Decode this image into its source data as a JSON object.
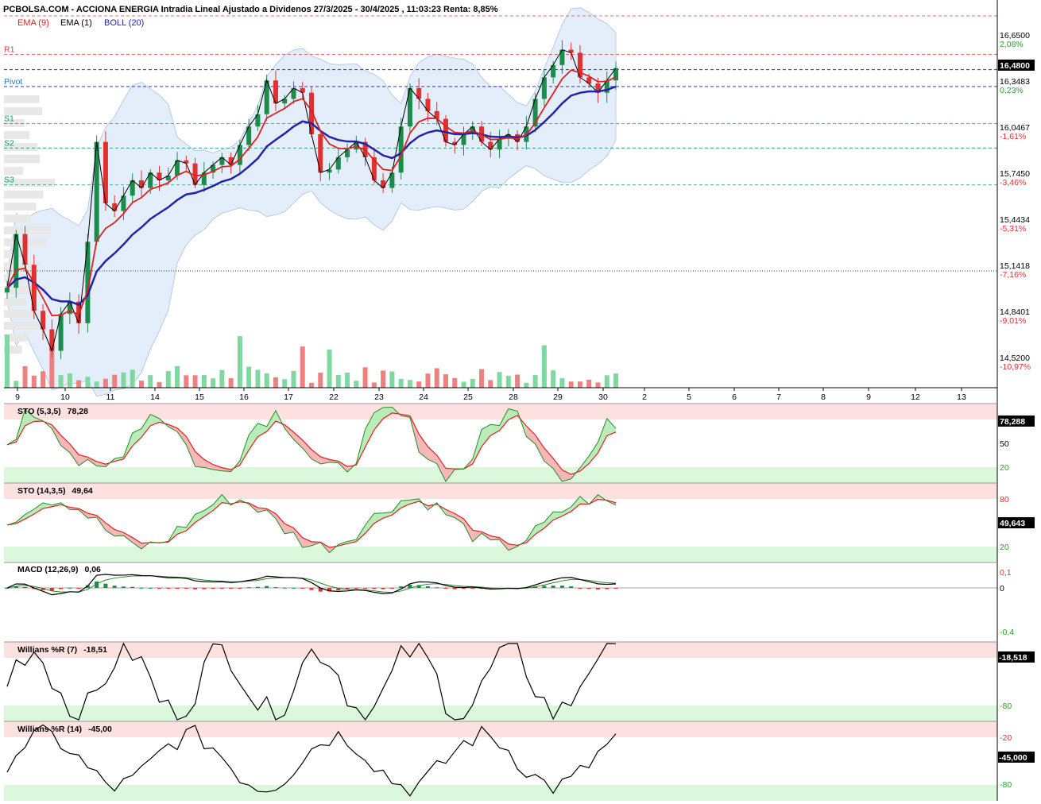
{
  "title": "PCBOLSA.COM - ACCIONA ENERGIA Intradia Lineal Ajustado a Dividenos 27/3/2025 - 30/4/2025 , 11:03:23 Renta: 8,85%",
  "legend": [
    {
      "label": "EMA (9)",
      "color": "#e02020"
    },
    {
      "label": "EMA (1)",
      "color": "#000000"
    },
    {
      "label": "BOLL (20)",
      "color": "#2020c0"
    }
  ],
  "colors": {
    "up": "#1c8c4c",
    "down": "#e03030",
    "volUp": "#7ed8a0",
    "volDown": "#ee8080",
    "ema9": "#e02020",
    "ema20": "#2222aa",
    "boll": "#c8dcf4",
    "pivot": "#1a1aa8",
    "overbought": "#fde0e0",
    "oversold": "#dcf8dc"
  },
  "chart_data": [
    {
      "type": "candlestick",
      "ylim": [
        14.4,
        16.82
      ],
      "price_ticks": [
        {
          "value": "16,6500",
          "pct": "2,08%"
        },
        {
          "value": "16,3483",
          "pct": "0,23%"
        },
        {
          "value": "16,0467",
          "pct": "-1,61%"
        },
        {
          "value": "15,7450",
          "pct": "-3,46%"
        },
        {
          "value": "15,4434",
          "pct": "-5,31%"
        },
        {
          "value": "15,1418",
          "pct": "-7,16%"
        },
        {
          "value": "14,8401",
          "pct": "-9,01%"
        },
        {
          "value": "14,5200",
          "pct": "-10,97%"
        }
      ],
      "last_price": "16,4800",
      "levels": [
        {
          "name": "R1",
          "value": 16.57,
          "color": "#e04040"
        },
        {
          "name": "Pivot",
          "value": 16.36,
          "color": "#1a7ad0"
        },
        {
          "name": "S1",
          "value": 16.12,
          "color": "#1a9a6a"
        },
        {
          "name": "S2",
          "value": 15.96,
          "color": "#1a9a6a"
        },
        {
          "name": "S3",
          "value": 15.72,
          "color": "#1a9a6a"
        }
      ],
      "x_ticks": [
        "9",
        "10",
        "11",
        "14",
        "15",
        "16",
        "17",
        "22",
        "23",
        "24",
        "25",
        "28",
        "29",
        "30",
        "2",
        "5",
        "6",
        "7",
        "8",
        "9",
        "12",
        "13"
      ],
      "close": [
        15.05,
        15.4,
        15.2,
        14.9,
        14.78,
        14.64,
        14.88,
        14.96,
        14.82,
        15.35,
        16.0,
        15.6,
        15.55,
        15.65,
        15.75,
        15.7,
        15.8,
        15.75,
        15.78,
        15.88,
        15.86,
        15.72,
        15.8,
        15.85,
        15.9,
        15.85,
        15.98,
        16.1,
        16.18,
        16.4,
        16.25,
        16.28,
        16.35,
        16.32,
        16.05,
        15.8,
        15.82,
        15.9,
        15.95,
        16.0,
        15.9,
        15.75,
        15.7,
        15.8,
        16.1,
        16.35,
        16.28,
        16.2,
        16.15,
        16.0,
        15.98,
        16.05,
        16.1,
        16.0,
        15.95,
        16.02,
        16.05,
        16.0,
        16.1,
        16.28,
        16.42,
        16.5,
        16.6,
        16.58,
        16.42,
        16.38,
        16.32,
        16.4,
        16.48
      ]
    },
    {
      "type": "line",
      "name": "STO (5,3,5)",
      "value": "78,28",
      "box": "78,288",
      "ticks": [
        "50",
        "20"
      ]
    },
    {
      "type": "line",
      "name": "STO (14,3,5)",
      "value": "49,64",
      "box": "49,643",
      "ticks": [
        "80",
        "20"
      ]
    },
    {
      "type": "bar",
      "name": "MACD (12,26,9)",
      "value": "0,06",
      "ticks": [
        "0,1",
        "0",
        "-0,4"
      ]
    },
    {
      "type": "line",
      "name": "Willians %R (7)",
      "value": "-18,51",
      "box": "-18,518",
      "ticks": [
        "-80"
      ]
    },
    {
      "type": "line",
      "name": "Willians %R (14)",
      "value": "-45,00",
      "box": "-45,000",
      "ticks": [
        "-20",
        "-80"
      ]
    }
  ]
}
